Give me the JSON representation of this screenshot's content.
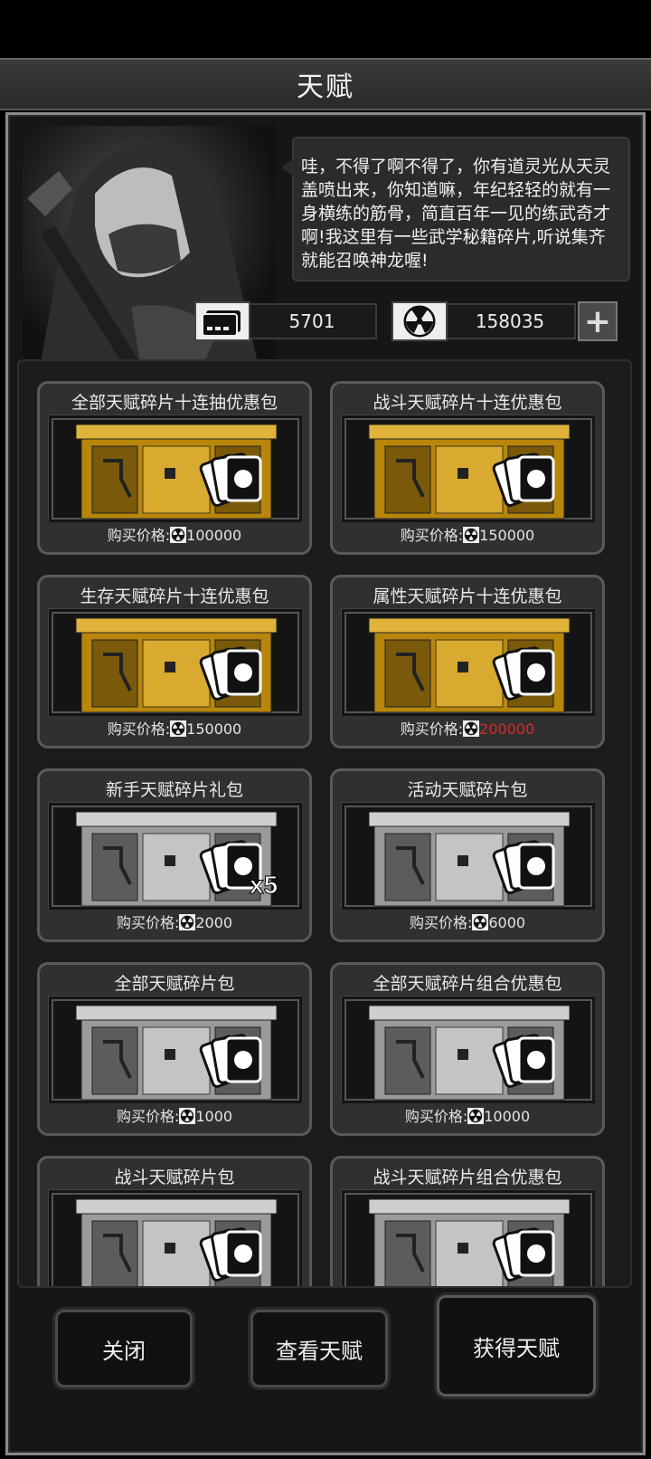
{
  "title": "天赋",
  "npc": {
    "speech": "哇，不得了啊不得了，你有道灵光从天灵盖喷出来，你知道嘛，年纪轻轻的就有一身横练的筋骨，简直百年一见的练武奇才啊!我这里有一些武学秘籍碎片,听说集齐就能召唤神龙喔!"
  },
  "currency": {
    "tickets": {
      "icon": "ticket-icon",
      "value": "5701"
    },
    "radiation": {
      "icon": "radiation-icon",
      "value": "158035"
    }
  },
  "price_label": "购买价格:",
  "packs": [
    {
      "name": "全部天赋碎片十连抽优惠包",
      "price": "100000",
      "chest": "gold",
      "price_color": "#e4e4e4"
    },
    {
      "name": "战斗天赋碎片十连优惠包",
      "price": "150000",
      "chest": "gold",
      "price_color": "#e4e4e4"
    },
    {
      "name": "生存天赋碎片十连优惠包",
      "price": "150000",
      "chest": "gold",
      "price_color": "#e4e4e4"
    },
    {
      "name": "属性天赋碎片十连优惠包",
      "price": "200000",
      "chest": "gold",
      "price_color": "#d42b2b"
    },
    {
      "name": "新手天赋碎片礼包",
      "price": "2000",
      "chest": "silver",
      "badge": "x5",
      "price_color": "#e4e4e4"
    },
    {
      "name": "活动天赋碎片包",
      "price": "6000",
      "chest": "silver",
      "price_color": "#e4e4e4"
    },
    {
      "name": "全部天赋碎片包",
      "price": "1000",
      "chest": "silver",
      "price_color": "#e4e4e4"
    },
    {
      "name": "全部天赋碎片组合优惠包",
      "price": "10000",
      "chest": "silver",
      "price_color": "#e4e4e4"
    },
    {
      "name": "战斗天赋碎片包",
      "price": "",
      "chest": "silver",
      "price_color": "#e4e4e4"
    },
    {
      "name": "战斗天赋碎片组合优惠包",
      "price": "",
      "chest": "silver",
      "price_color": "#e4e4e4"
    }
  ],
  "buttons": {
    "close": "关闭",
    "view": "查看天赋",
    "get": "获得天赋"
  }
}
